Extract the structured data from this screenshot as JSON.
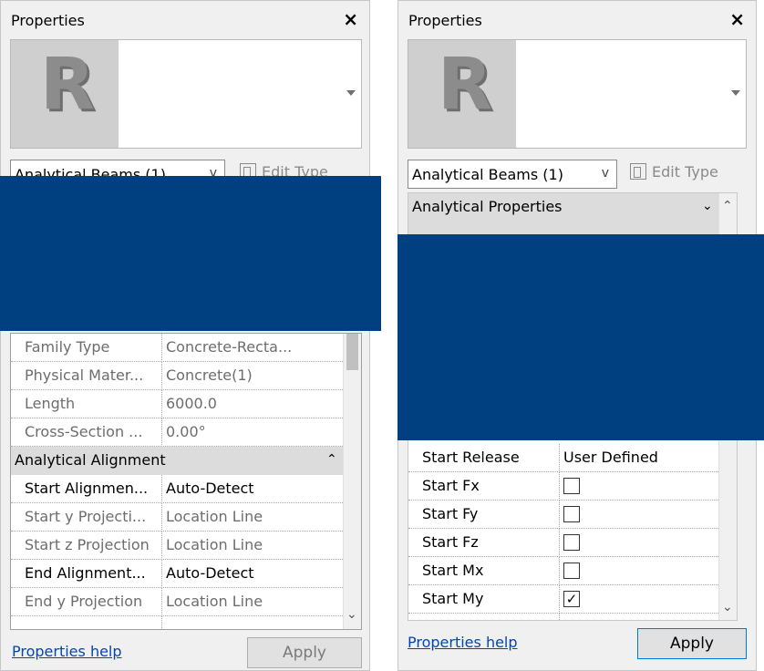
{
  "left_panel": {
    "title": "Properties",
    "close_glyph": "×",
    "logo_letter": "R",
    "type_selector": "Analytical Beams (1)",
    "selector_chevron": "v",
    "edit_type": "Edit Type",
    "rows": [
      {
        "name": "Family Type",
        "value": "Concrete-Recta...",
        "style": "grey"
      },
      {
        "name": "Physical Mater...",
        "value": "Concrete(1)",
        "style": "grey"
      },
      {
        "name": "Length",
        "value": "6000.0",
        "style": "grey"
      },
      {
        "name": "Cross-Section ...",
        "value": "0.00°",
        "style": "grey"
      }
    ],
    "section_header": "Analytical Alignment",
    "section_glyph": "⌃",
    "alignment_rows": [
      {
        "name": "Start Alignmen...",
        "value": "Auto-Detect",
        "style": "dark"
      },
      {
        "name": "Start y Projecti...",
        "value": "Location Line",
        "style": "grey"
      },
      {
        "name": "Start z Projection",
        "value": "Location Line",
        "style": "grey"
      },
      {
        "name": "End Alignment...",
        "value": "Auto-Detect",
        "style": "dark"
      },
      {
        "name": "End y Projection",
        "value": "Location Line",
        "style": "grey"
      }
    ],
    "help_link": "Properties help",
    "apply_label": "Apply"
  },
  "right_panel": {
    "title": "Properties",
    "close_glyph": "×",
    "logo_letter": "R",
    "type_selector": "Analytical Beams (1)",
    "selector_chevron": "v",
    "edit_type": "Edit Type",
    "section_header": "Analytical Properties",
    "section_glyph": "⌄",
    "rows": [
      {
        "name": "Start Release",
        "value": "User Defined",
        "checked": null
      },
      {
        "name": "Start Fx",
        "value": "",
        "checked": false
      },
      {
        "name": "Start Fy",
        "value": "",
        "checked": false
      },
      {
        "name": "Start Fz",
        "value": "",
        "checked": false
      },
      {
        "name": "Start Mx",
        "value": "",
        "checked": false
      },
      {
        "name": "Start My",
        "value": "",
        "checked": true
      }
    ],
    "check_glyph": "✓",
    "help_link": "Properties help",
    "apply_label": "Apply"
  },
  "colors": {
    "redaction": "#004080",
    "panel_bg": "#f0f0f0",
    "header_bg": "#dcdcdc",
    "link": "#0645ad"
  }
}
